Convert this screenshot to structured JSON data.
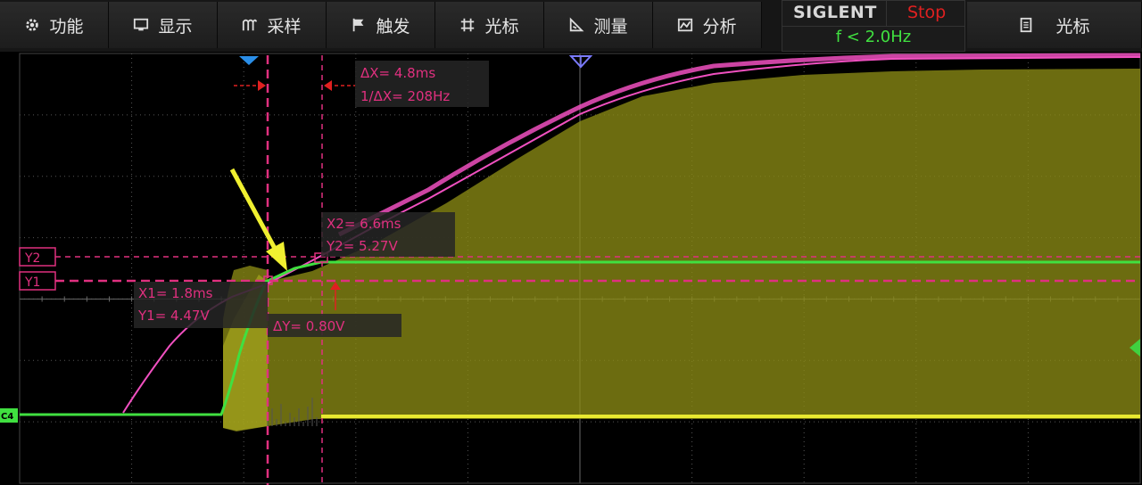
{
  "menu": [
    {
      "id": "function",
      "label": "功能",
      "icon": "gear-icon"
    },
    {
      "id": "display",
      "label": "显示",
      "icon": "monitor-icon"
    },
    {
      "id": "acquire",
      "label": "采样",
      "icon": "sampling-icon"
    },
    {
      "id": "trigger",
      "label": "触发",
      "icon": "flag-icon"
    },
    {
      "id": "cursors",
      "label": "光标",
      "icon": "crosshair-icon"
    },
    {
      "id": "measure",
      "label": "测量",
      "icon": "measure-icon"
    },
    {
      "id": "analysis",
      "label": "分析",
      "icon": "analysis-icon"
    }
  ],
  "brand": "SIGLENT",
  "run_state": "Stop",
  "trigger_freq": "f < 2.0Hz",
  "right_menu": {
    "label": "光标",
    "icon": "document-icon"
  },
  "colors": {
    "c1_trace": "#f050c0",
    "c4_trace": "#40e040",
    "yellow_trace": "#e8e830",
    "cursor": "#e0307f",
    "trigger_marker_blue": "#2a8ee8",
    "run_state": "#e02020",
    "trigger_freq": "#40e040"
  },
  "cursors": {
    "delta_x": "ΔX= 4.8ms",
    "inv_delta_x": "1/ΔX= 208Hz",
    "x1": "X1= 1.8ms",
    "y1": "Y1= 4.47V",
    "x2": "X2= 6.6ms",
    "y2": "Y2= 5.27V",
    "delta_y": "ΔY= 0.80V",
    "y1_tag": "Y1",
    "y2_tag": "Y2"
  },
  "channel_tag": "C4"
}
